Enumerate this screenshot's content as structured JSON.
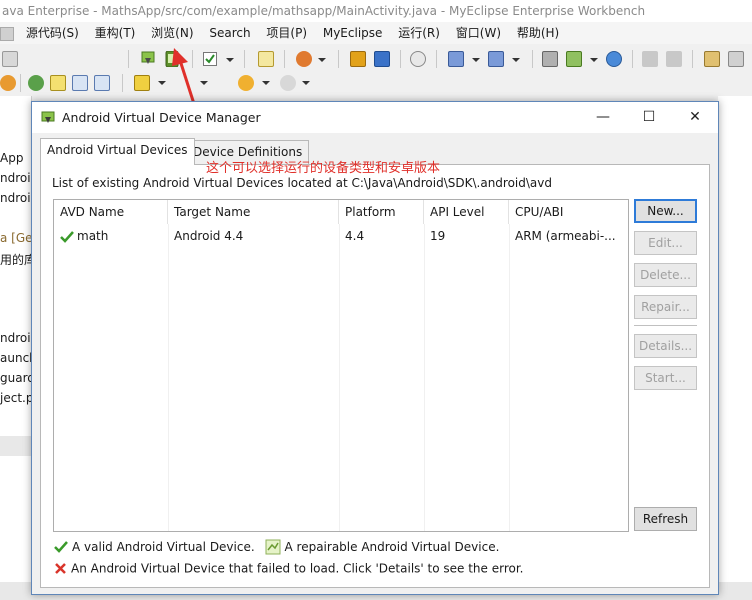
{
  "ide": {
    "title": "ava Enterprise  -  MathsApp/src/com/example/mathsapp/MainActivity.java  -  MyEclipse Enterprise Workbench",
    "menu": [
      "源代码(S)",
      "重构(T)",
      "浏览(N)",
      "Search",
      "项目(P)",
      "MyEclipse",
      "运行(R)",
      "窗口(W)",
      "帮助(H)"
    ],
    "left_panel": [
      "App",
      "ndroid",
      "ndroid",
      "a [Ger",
      "用的库",
      "ndroidN",
      "aunch",
      "guard",
      "ject.p"
    ]
  },
  "annotation": {
    "text": "这个可以选择运行的设备类型和安卓版本",
    "color": "#e0302a"
  },
  "dialog": {
    "title": "Android Virtual Device Manager",
    "tabs": [
      "Android Virtual Devices",
      "Device Definitions"
    ],
    "list_label": "List of existing Android Virtual Devices located at C:\\Java\\Android\\SDK\\.android\\avd",
    "columns": [
      "AVD Name",
      "Target Name",
      "Platform",
      "API Level",
      "CPU/ABI"
    ],
    "rows": [
      {
        "name": "math",
        "target": "Android 4.4",
        "platform": "4.4",
        "api": "19",
        "abi": "ARM (armeabi-..."
      }
    ],
    "buttons": {
      "new": "New...",
      "edit": "Edit...",
      "delete": "Delete...",
      "repair": "Repair...",
      "details": "Details...",
      "start": "Start...",
      "refresh": "Refresh"
    },
    "legend": {
      "valid": "A valid Android Virtual Device.",
      "repairable": "A repairable Android Virtual Device.",
      "failed": "An Android Virtual Device that failed to load. Click 'Details' to see the error."
    }
  },
  "colors": {
    "valid_check": "#3a9a2a",
    "error_x": "#d9342a",
    "accent": "#2e7bd8"
  }
}
